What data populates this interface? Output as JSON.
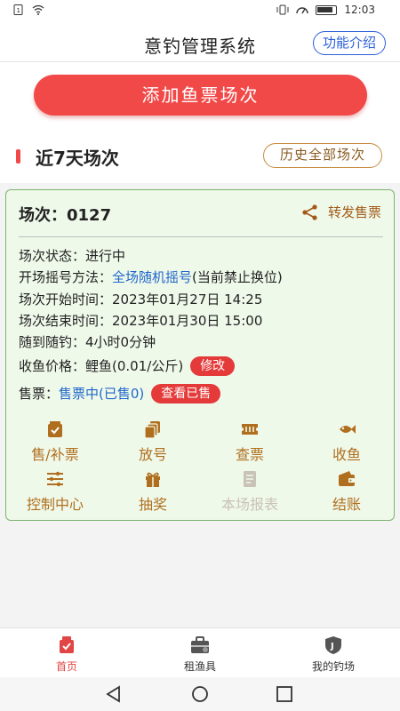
{
  "status": {
    "time": "12:03"
  },
  "header": {
    "title": "意钓管理系统",
    "intro_label": "功能介绍"
  },
  "main": {
    "add_button": "添加鱼票场次",
    "section_title": "近7天场次",
    "history_button": "历史全部场次"
  },
  "session": {
    "header_label": "场次：",
    "number": "0127",
    "share_label": "转发售票",
    "status_label": "场次状态：",
    "status_value": "进行中",
    "draw_label": "开场摇号方法：",
    "draw_value": "全场随机摇号",
    "draw_note": "(当前禁止换位)",
    "start_label": "场次开始时间：",
    "start_value": "2023年01月27日 14:25",
    "end_label": "场次结束时间：",
    "end_value": "2023年01月30日 15:00",
    "duration_label": "随到随钓：",
    "duration_value": "4小时0分钟",
    "price_label": "收鱼价格：",
    "price_value": "鲤鱼(0.01/公斤)",
    "edit_button": "修改",
    "tickets_label": "售票：",
    "tickets_value": "售票中(已售0)",
    "view_sold_button": "查看已售"
  },
  "actions": [
    {
      "label": "售/补票",
      "icon": "ticket-sale-icon"
    },
    {
      "label": "放号",
      "icon": "number-cards-icon"
    },
    {
      "label": "查票",
      "icon": "ticket-check-icon"
    },
    {
      "label": "收鱼",
      "icon": "fish-icon"
    },
    {
      "label": "控制中心",
      "icon": "sliders-icon"
    },
    {
      "label": "抽奖",
      "icon": "gift-icon"
    },
    {
      "label": "本场报表",
      "icon": "report-icon",
      "disabled": true
    },
    {
      "label": "结账",
      "icon": "wallet-icon"
    }
  ],
  "tabbar": [
    {
      "label": "首页",
      "active": true
    },
    {
      "label": "租渔具",
      "active": false
    },
    {
      "label": "我的钓场",
      "active": false
    }
  ],
  "colors": {
    "accent_red": "#f14848",
    "accent_blue": "#2b5fd9",
    "brown": "#b06f1e",
    "card_bg": "#eff9ea"
  }
}
